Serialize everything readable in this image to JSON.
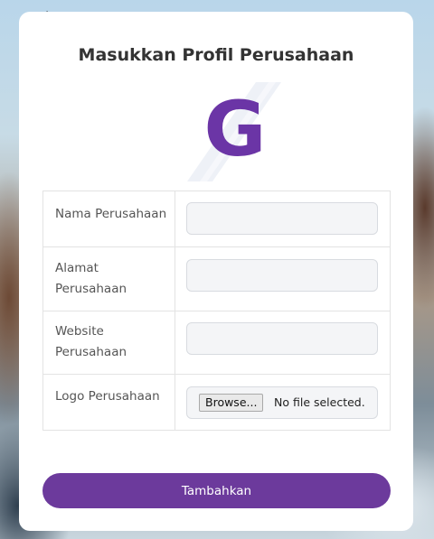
{
  "page": {
    "title": "Masukkan Profil Perusahaan"
  },
  "logo": {
    "letter": "G",
    "color": "#6b35a6"
  },
  "form": {
    "fields": [
      {
        "label": "Nama Perusahaan",
        "value": "",
        "placeholder": ""
      },
      {
        "label": "Alamat Perusahaan",
        "value": "",
        "placeholder": ""
      },
      {
        "label": "Website Perusahaan",
        "value": "",
        "placeholder": ""
      }
    ],
    "logo_field": {
      "label": "Logo Perusahaan",
      "browse_label": "Browse...",
      "status": "No file selected."
    }
  },
  "submit": {
    "label": "Tambahkan",
    "color": "#6c3a9c"
  }
}
